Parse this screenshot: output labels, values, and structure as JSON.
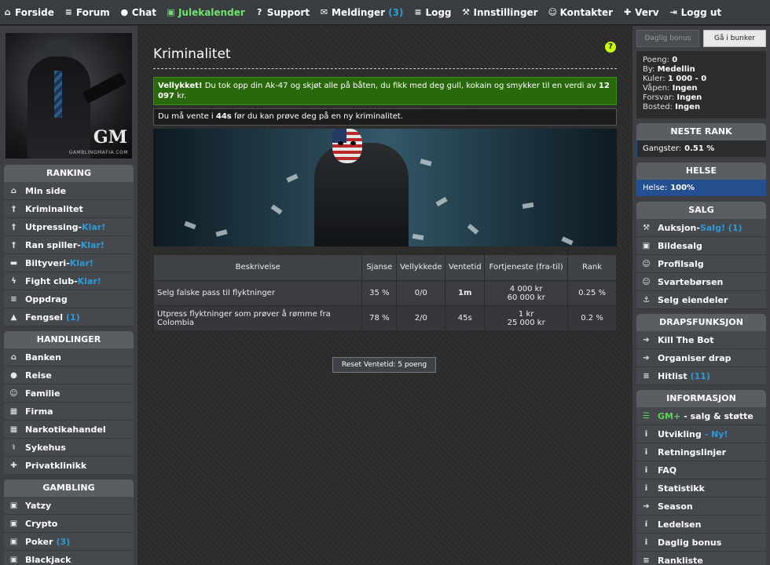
{
  "topnav": [
    {
      "icon": "home-icon",
      "glyph": "⌂",
      "label": "Forside",
      "green": false,
      "count": ""
    },
    {
      "icon": "list-icon",
      "glyph": "≡",
      "label": "Forum",
      "green": false,
      "count": ""
    },
    {
      "icon": "chat-icon",
      "glyph": "●",
      "label": "Chat",
      "green": false,
      "count": ""
    },
    {
      "icon": "gift-icon",
      "glyph": "▣",
      "label": "Julekalender",
      "green": true,
      "count": ""
    },
    {
      "icon": "question-icon",
      "glyph": "?",
      "label": "Support",
      "green": false,
      "count": ""
    },
    {
      "icon": "envelope-icon",
      "glyph": "✉",
      "label": "Meldinger",
      "green": false,
      "count": "(3)"
    },
    {
      "icon": "log-icon",
      "glyph": "≡",
      "label": "Logg",
      "green": false,
      "count": ""
    },
    {
      "icon": "wrench-icon",
      "glyph": "⚒",
      "label": "Innstillinger",
      "green": false,
      "count": ""
    },
    {
      "icon": "users-icon",
      "glyph": "☺",
      "label": "Kontakter",
      "green": false,
      "count": ""
    },
    {
      "icon": "user-plus-icon",
      "glyph": "✚",
      "label": "Verv",
      "green": false,
      "count": ""
    },
    {
      "icon": "logout-icon",
      "glyph": "⇥",
      "label": "Logg ut",
      "green": false,
      "count": ""
    }
  ],
  "avatar": {
    "logo": "GM",
    "url": "GAMBLINGMAFIA.COM"
  },
  "left": {
    "ranking": {
      "title": "RANKING",
      "items": [
        {
          "icon": "home-icon",
          "glyph": "⌂",
          "label": "Min side",
          "extra": ""
        },
        {
          "icon": "person-icon",
          "glyph": "†",
          "label": "Kriminalitet",
          "extra": ""
        },
        {
          "icon": "person-icon",
          "glyph": "†",
          "label": "Utpressing",
          "extra": "Klar!"
        },
        {
          "icon": "person-icon",
          "glyph": "†",
          "label": "Ran spiller",
          "extra": "Klar!"
        },
        {
          "icon": "car-icon",
          "glyph": "▬",
          "label": "Biltyveri",
          "extra": "Klar!"
        },
        {
          "icon": "bolt-icon",
          "glyph": "ϟ",
          "label": "Fight club",
          "extra": "Klar!"
        },
        {
          "icon": "list-icon",
          "glyph": "≡",
          "label": "Oppdrag",
          "extra": ""
        },
        {
          "icon": "lock-icon",
          "glyph": "▲",
          "label": "Fengsel",
          "extra": "(1)"
        }
      ]
    },
    "handlinger": {
      "title": "HANDLINGER",
      "items": [
        {
          "icon": "bank-icon",
          "glyph": "⌂",
          "label": "Banken"
        },
        {
          "icon": "globe-icon",
          "glyph": "●",
          "label": "Reise"
        },
        {
          "icon": "users-icon",
          "glyph": "☺",
          "label": "Familie"
        },
        {
          "icon": "building-icon",
          "glyph": "▦",
          "label": "Firma"
        },
        {
          "icon": "grid-icon",
          "glyph": "▦",
          "label": "Narkotikahandel"
        },
        {
          "icon": "hospital-icon",
          "glyph": "⚕",
          "label": "Sykehus"
        },
        {
          "icon": "medkit-icon",
          "glyph": "✚",
          "label": "Privatklinikk"
        }
      ]
    },
    "gambling": {
      "title": "GAMBLING",
      "items": [
        {
          "icon": "money-icon",
          "glyph": "▣",
          "label": "Yatzy",
          "extra": ""
        },
        {
          "icon": "money-icon",
          "glyph": "▣",
          "label": "Crypto",
          "extra": ""
        },
        {
          "icon": "money-icon",
          "glyph": "▣",
          "label": "Poker",
          "extra": "(3)"
        },
        {
          "icon": "money-icon",
          "glyph": "▣",
          "label": "Blackjack",
          "extra": ""
        }
      ]
    }
  },
  "main": {
    "title": "Kriminalitet",
    "success_bold": "Vellykket!",
    "success_text": "Du tok opp din Ak-47 og skjøt alle på båten, du fikk med deg gull, kokain og smykker til en verdi av",
    "success_amount": "12 097",
    "success_unit": "kr.",
    "wait_pre": "Du må vente i",
    "wait_time": "44s",
    "wait_post": "før du kan prøve deg på en ny kriminalitet.",
    "table": {
      "headers": [
        "Beskrivelse",
        "Sjanse",
        "Vellykkede",
        "Ventetid",
        "Fortjeneste (fra-til)",
        "Rank"
      ],
      "rows": [
        {
          "desc": "Selg falske pass til flyktninger",
          "chance": "35 %",
          "success": "0/0",
          "wait": "1m",
          "from": "4 000 kr",
          "to": "60 000 kr",
          "rank": "0.25 %"
        },
        {
          "desc": "Utpress flyktninger som prøver å rømme fra Colombia",
          "chance": "78 %",
          "success": "2/0",
          "wait": "45s",
          "from": "1 kr",
          "to": "25 000 kr",
          "rank": "0.2 %"
        }
      ]
    },
    "reset_label": "Reset Ventetid: 5 poeng"
  },
  "right": {
    "daily_bonus": "Daglig bonus",
    "bunker": "Gå i bunker",
    "stats": [
      {
        "label": "Poeng:",
        "value": "0"
      },
      {
        "label": "By:",
        "value": "Medellin"
      },
      {
        "label": "Kuler:",
        "value": "1 000 - 0"
      },
      {
        "label": "Våpen:",
        "value": "Ingen"
      },
      {
        "label": "Forsvar:",
        "value": "Ingen"
      },
      {
        "label": "Bosted:",
        "value": "Ingen"
      }
    ],
    "next_rank": {
      "title": "NESTE RANK",
      "label": "Gangster:",
      "value": "0.51 %",
      "percent": 0.51
    },
    "health": {
      "title": "HELSE",
      "label": "Helse:",
      "value": "100%",
      "percent": 100
    },
    "salg": {
      "title": "SALG",
      "items": [
        {
          "icon": "gavel-icon",
          "glyph": "⚒",
          "label": "Auksjon",
          "extra": "Salg! (1)"
        },
        {
          "icon": "camera-icon",
          "glyph": "▣",
          "label": "Bildesalg",
          "extra": ""
        },
        {
          "icon": "user-icon",
          "glyph": "☺",
          "label": "Profilsalg",
          "extra": ""
        },
        {
          "icon": "users-icon",
          "glyph": "☺",
          "label": "Svartebørsen",
          "extra": ""
        },
        {
          "icon": "anchor-icon",
          "glyph": "⚓",
          "label": "Selg eiendeler",
          "extra": ""
        }
      ]
    },
    "drap": {
      "title": "DRAPSFUNKSJON",
      "items": [
        {
          "icon": "arrow-right-icon",
          "glyph": "➔",
          "label": "Kill The Bot",
          "extra": ""
        },
        {
          "icon": "arrow-right-icon",
          "glyph": "➔",
          "label": "Organiser drap",
          "extra": ""
        },
        {
          "icon": "list-icon",
          "glyph": "≡",
          "label": "Hitlist",
          "extra": "(11)"
        }
      ]
    },
    "info": {
      "title": "INFORMASJON",
      "items": [
        {
          "icon": "cart-icon",
          "glyph": "☰",
          "label": "GM+",
          "extra": "- salg & støtte",
          "type": "green"
        },
        {
          "icon": "info-icon",
          "glyph": "i",
          "label": "Utvikling",
          "extra": "- Ny!",
          "type": "new"
        },
        {
          "icon": "info-icon",
          "glyph": "i",
          "label": "Retningslinjer",
          "extra": "",
          "type": ""
        },
        {
          "icon": "info-icon",
          "glyph": "i",
          "label": "FAQ",
          "extra": "",
          "type": ""
        },
        {
          "icon": "info-icon",
          "glyph": "i",
          "label": "Statistikk",
          "extra": "",
          "type": ""
        },
        {
          "icon": "arrow-right-icon",
          "glyph": "➔",
          "label": "Season",
          "extra": "",
          "type": ""
        },
        {
          "icon": "info-icon",
          "glyph": "i",
          "label": "Ledelsen",
          "extra": "",
          "type": ""
        },
        {
          "icon": "info-icon",
          "glyph": "i",
          "label": "Daglig bonus",
          "extra": "",
          "type": ""
        },
        {
          "icon": "list-icon",
          "glyph": "≡",
          "label": "Rankliste",
          "extra": "",
          "type": ""
        }
      ]
    }
  },
  "colors": {
    "accent_blue": "#2e9bd6",
    "success_green": "#29690b",
    "health_blue": "#24508f",
    "julekalender_green": "#6fe36f"
  }
}
